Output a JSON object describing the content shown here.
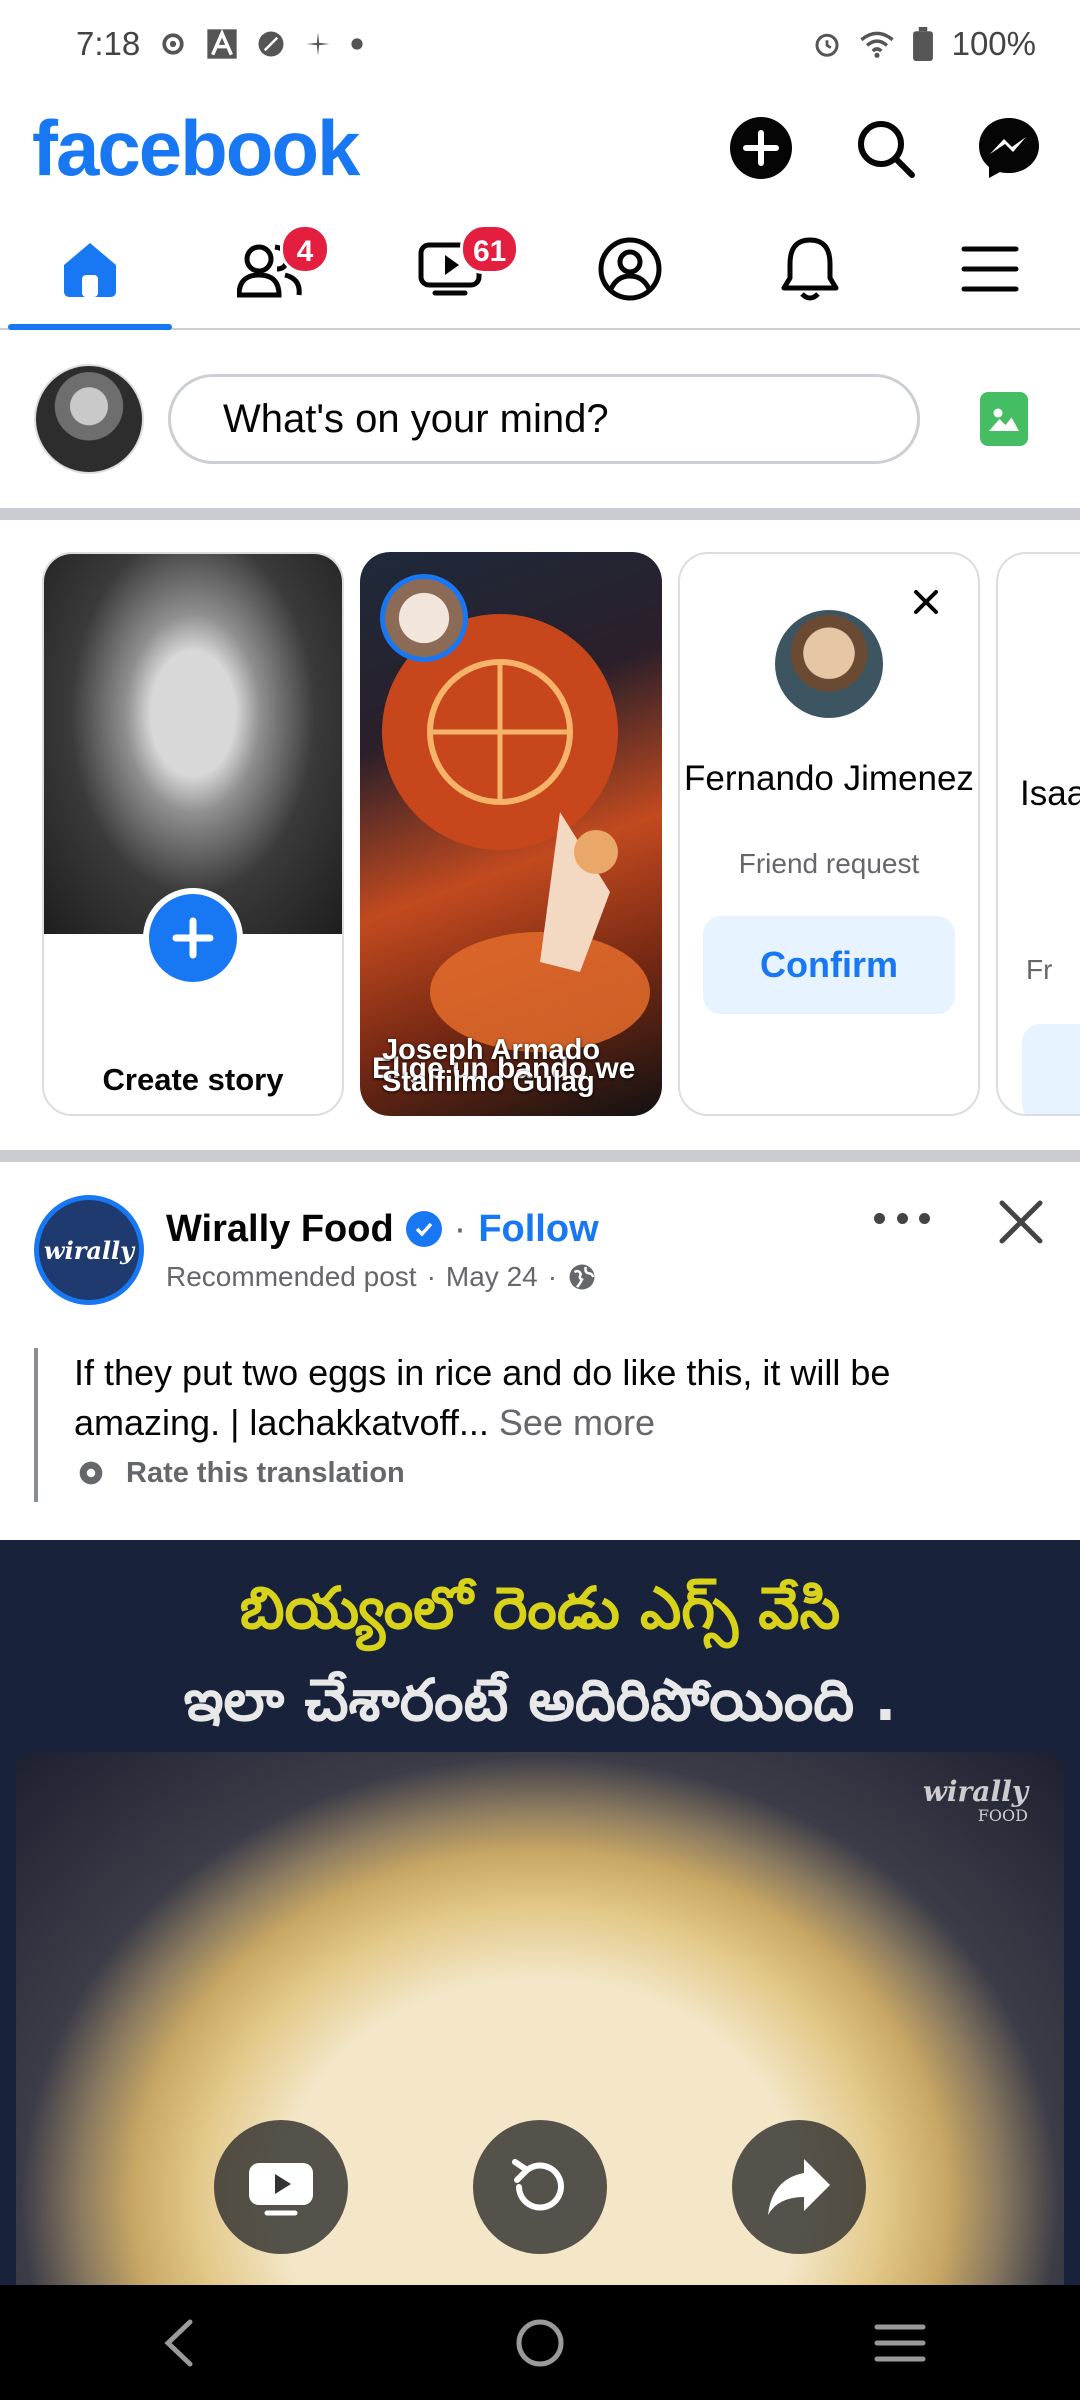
{
  "status_bar": {
    "time": "7:18",
    "battery": "100%",
    "icons": [
      "settings-icon",
      "a-icon",
      "leaf-icon",
      "pinwheel-icon",
      "dot-icon",
      "alarm-icon",
      "wifi-icon",
      "battery-icon"
    ]
  },
  "header": {
    "logo": "facebook",
    "actions": [
      "add-icon",
      "search-icon",
      "messenger-icon"
    ]
  },
  "nav": {
    "tabs": [
      {
        "name": "home",
        "icon": "home-icon",
        "active": true,
        "badge": ""
      },
      {
        "name": "friends",
        "icon": "friends-icon",
        "active": false,
        "badge": "4"
      },
      {
        "name": "watch",
        "icon": "video-icon",
        "active": false,
        "badge": "61"
      },
      {
        "name": "profile",
        "icon": "profile-icon",
        "active": false,
        "badge": ""
      },
      {
        "name": "notifications",
        "icon": "bell-icon",
        "active": false,
        "badge": ""
      },
      {
        "name": "menu",
        "icon": "hamburger-icon",
        "active": false,
        "badge": ""
      }
    ]
  },
  "composer": {
    "placeholder": "What's on your mind?"
  },
  "stories": {
    "create_label": "Create story",
    "story": {
      "name": "Joseph Armado Stalfilmo Gulag",
      "overlay_text": "Elige un bando we"
    },
    "friend_request": {
      "name": "Fernando Jimenez",
      "subtitle": "Friend request",
      "confirm_label": "Confirm"
    },
    "partial_card": {
      "name": "Isaa",
      "subtitle": "Fr"
    }
  },
  "post": {
    "page_name": "Wirally Food",
    "follow_label": "Follow",
    "separator": "·",
    "subtitle": "Recommended post",
    "date": "May 24",
    "avatar_text": "wirally",
    "body": "If they put two eggs in rice and do like this, it will be amazing. | lachakkatvoff...",
    "see_more": "See more",
    "rate_translation": "Rate this translation",
    "media_caption_line1": "బియ్యంలో రెండు ఎగ్స్ వేసి",
    "media_caption_line2": "ఇలా చేశారంటే అదిరిపోయింది .",
    "watermark": "wirally",
    "watermark_sub": "FOOD",
    "controls": [
      "youtube-icon",
      "replay-icon",
      "share-icon"
    ]
  },
  "colors": {
    "brand": "#1877f2",
    "badge": "#e41e3f",
    "caption_yellow": "#d9d21a"
  }
}
